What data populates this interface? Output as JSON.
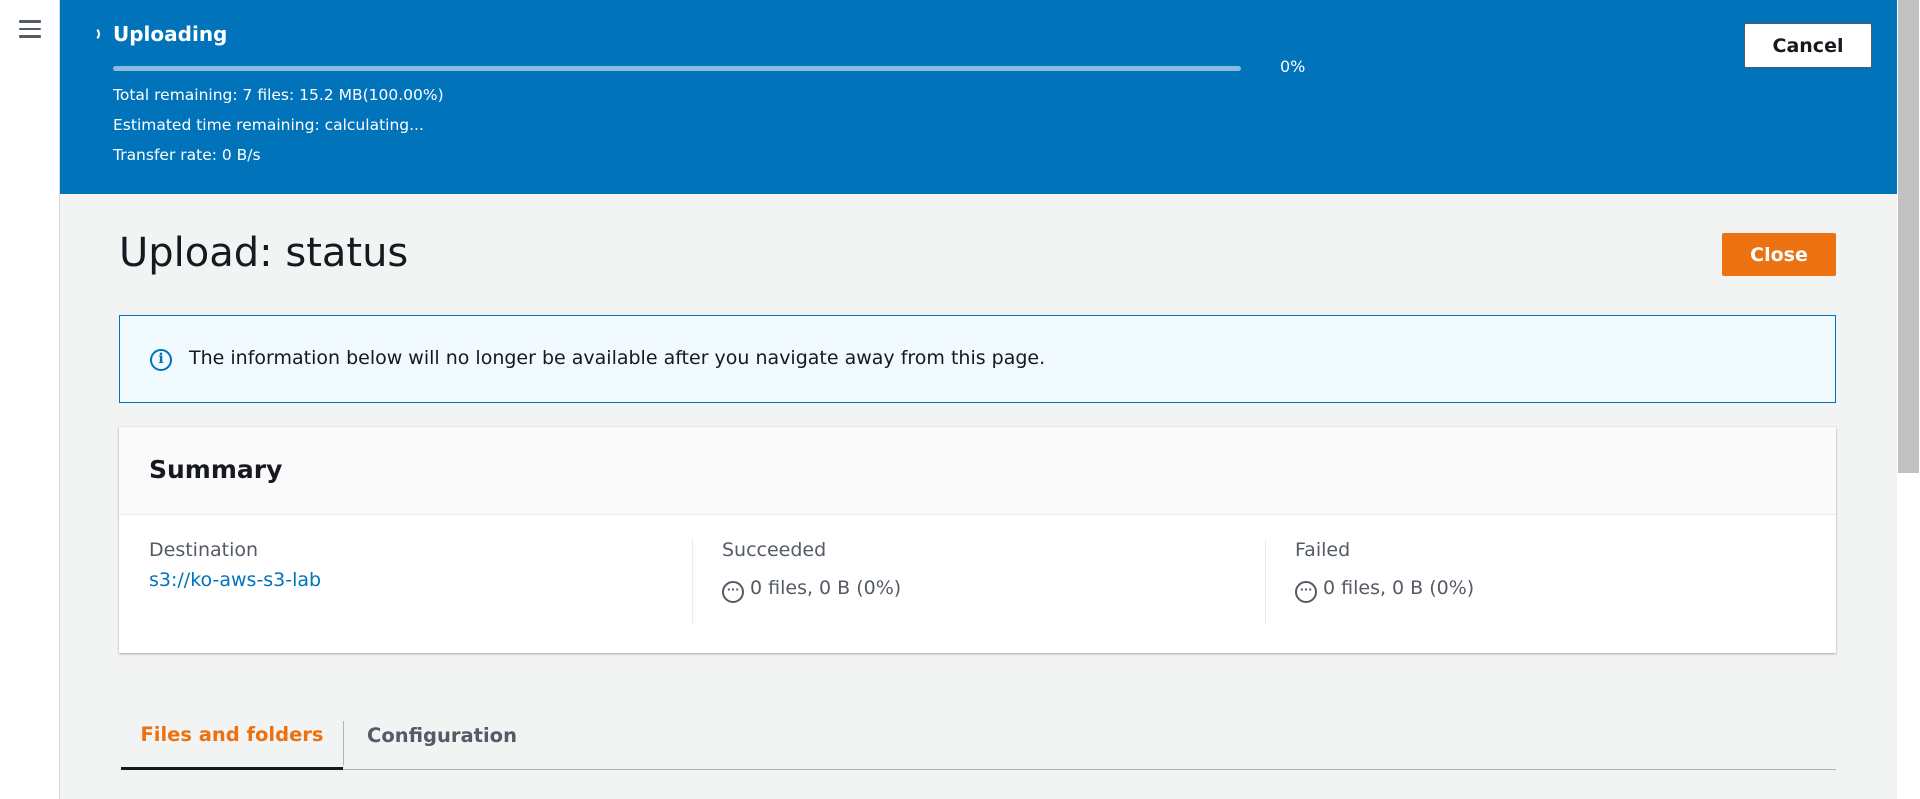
{
  "banner": {
    "title": "Uploading",
    "progress_percent": 0,
    "progress_label": "0%",
    "total_remaining": "Total remaining: 7 files: 15.2 MB(100.00%)",
    "estimated_time": "Estimated time remaining: calculating...",
    "transfer_rate": "Transfer rate: 0 B/s",
    "cancel_label": "Cancel",
    "color": "#0073bb"
  },
  "page": {
    "title": "Upload: status",
    "close_label": "Close",
    "accent_color": "#ec7211"
  },
  "alert": {
    "icon": "info-icon",
    "text": "The information below will no longer be available after you navigate away from this page."
  },
  "summary": {
    "title": "Summary",
    "destination": {
      "label": "Destination",
      "value": "s3://ko-aws-s3-lab"
    },
    "succeeded": {
      "label": "Succeeded",
      "icon": "pending-icon",
      "value": "0 files, 0 B (0%)"
    },
    "failed": {
      "label": "Failed",
      "icon": "pending-icon",
      "value": "0 files, 0 B (0%)"
    }
  },
  "tabs": [
    {
      "label": "Files and folders",
      "active": true
    },
    {
      "label": "Configuration",
      "active": false
    }
  ]
}
